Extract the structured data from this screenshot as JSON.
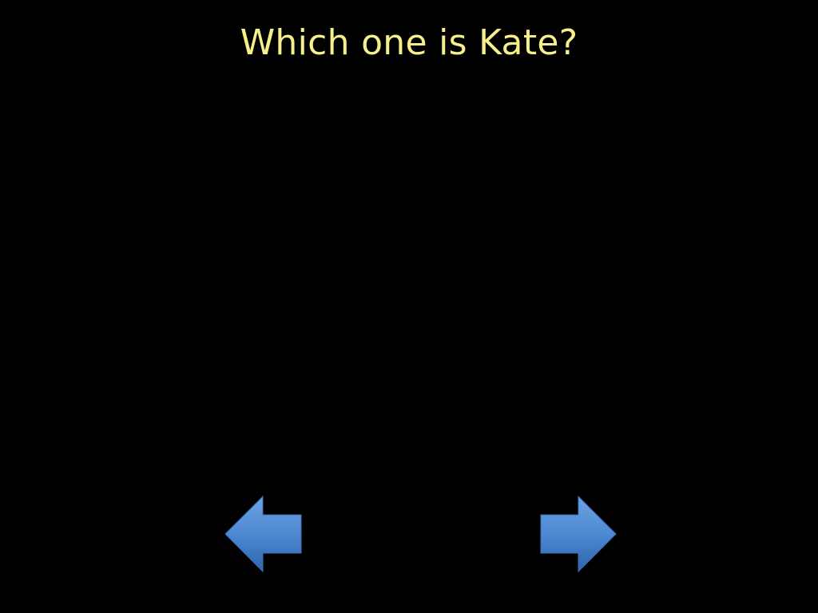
{
  "slide": {
    "title": "Which one is Kate?"
  },
  "navigation": {
    "previous_icon": "arrow-left-icon",
    "next_icon": "arrow-right-icon",
    "arrow_color": "#4a86d0",
    "arrow_color_dark": "#2f63a8",
    "arrow_color_light": "#6fa3e3"
  },
  "colors": {
    "background": "#000000",
    "title": "#f7f08a"
  }
}
